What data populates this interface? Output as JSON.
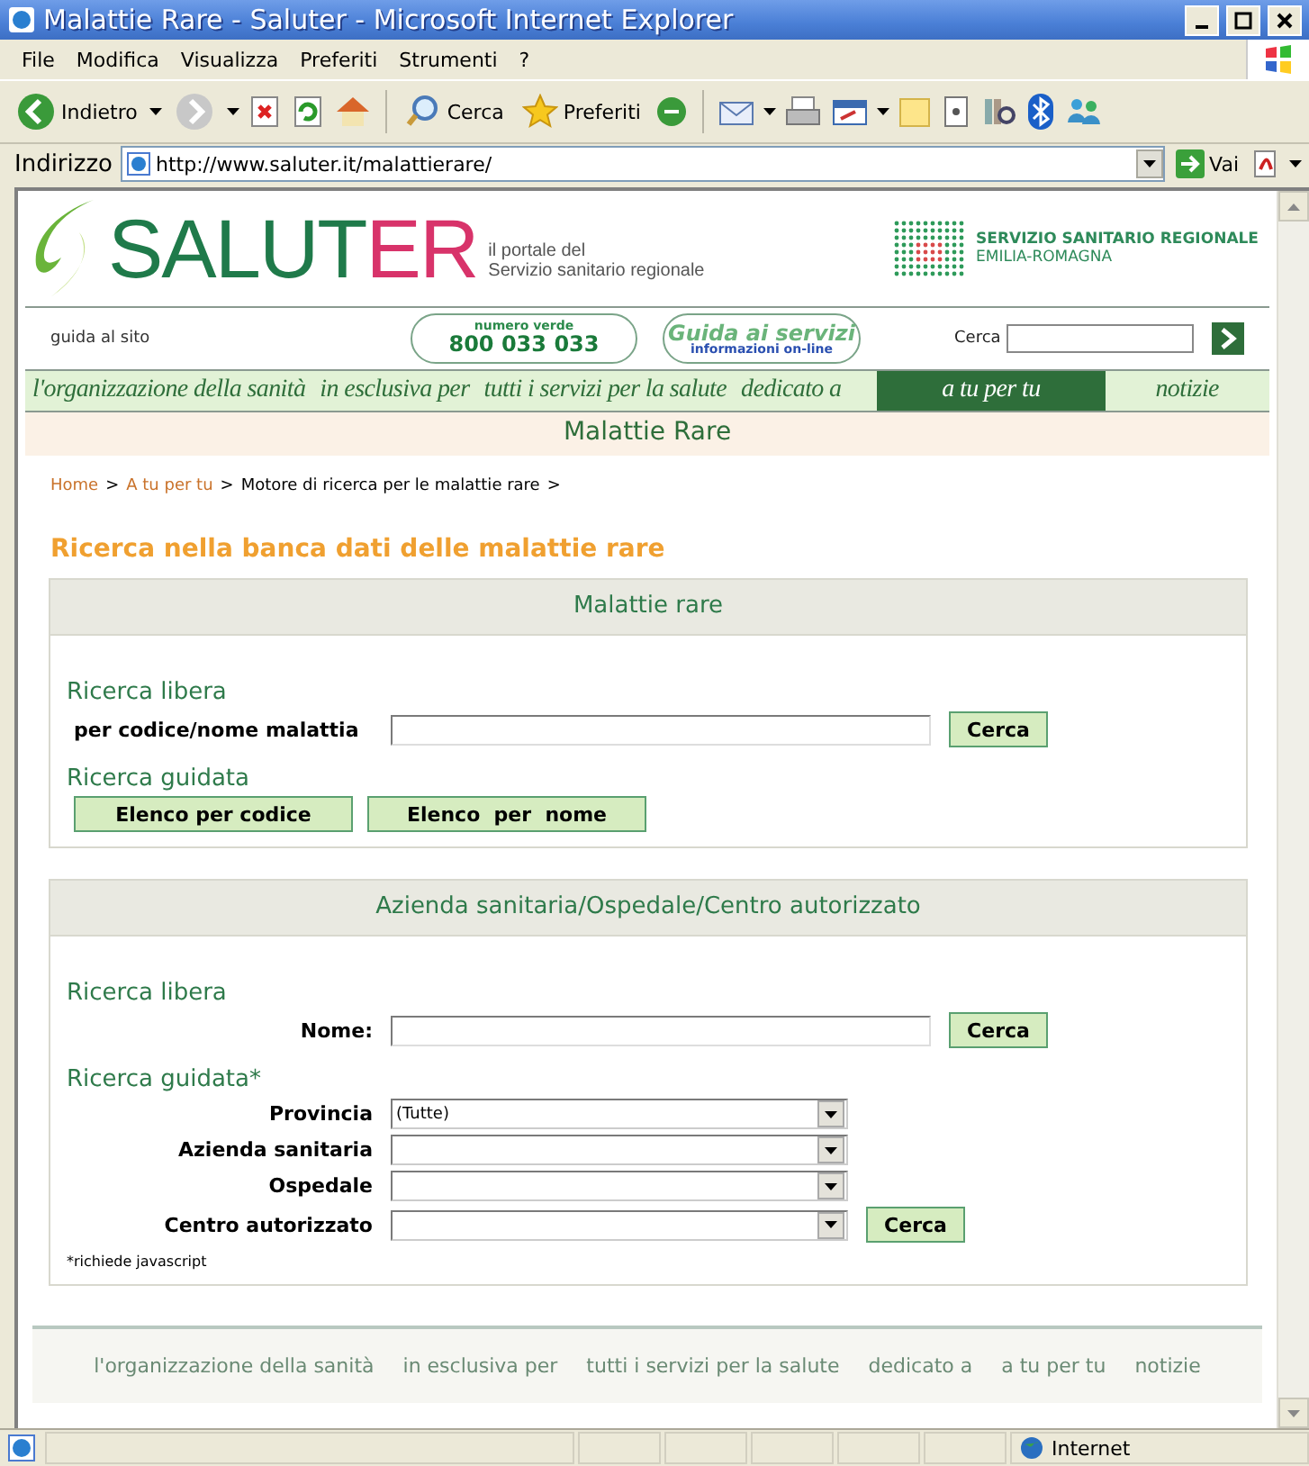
{
  "window": {
    "title": "Malattie Rare - Saluter - Microsoft Internet Explorer"
  },
  "menu": [
    "File",
    "Modifica",
    "Visualizza",
    "Preferiti",
    "Strumenti",
    "?"
  ],
  "toolbar": {
    "back": "Indietro",
    "search": "Cerca",
    "favorites": "Preferiti"
  },
  "address": {
    "label": "Indirizzo",
    "url": "http://www.saluter.it/malattierare/",
    "go": "Vai"
  },
  "header": {
    "logo_start": "SALUT",
    "logo_end": "ER",
    "tagline_1": "il portale del",
    "tagline_2": "Servizio sanitario regionale",
    "region_1": "SERVIZIO SANITARIO REGIONALE",
    "region_2": "EMILIA-ROMAGNA"
  },
  "utility": {
    "guide": "guida al sito",
    "phone_caption": "numero verde",
    "phone": "800 033 033",
    "services_title": "Guida ai servizi",
    "services_caption": "informazioni on-line",
    "search_label": "Cerca"
  },
  "nav": [
    {
      "label": "l'organizzazione della sanità",
      "selected": false
    },
    {
      "label": "in esclusiva per",
      "selected": false
    },
    {
      "label": "tutti i servizi per la salute",
      "selected": false
    },
    {
      "label": "dedicato a",
      "selected": false
    },
    {
      "label": "a tu per tu",
      "selected": true
    },
    {
      "label": "notizie",
      "selected": false
    }
  ],
  "section_title": "Malattie Rare",
  "breadcrumb": {
    "separator": ">",
    "items": [
      {
        "label": "Home",
        "link": true
      },
      {
        "label": "A tu per tu",
        "link": true
      },
      {
        "label": "Motore di ricerca per le malattie rare",
        "link": false
      }
    ]
  },
  "heading": "Ricerca nella banca dati delle malattie rare",
  "panels": [
    {
      "title": "Malattie rare",
      "groups": [
        {
          "heading": "Ricerca libera",
          "rows": [
            {
              "kind": "text",
              "label": "per codice/nome malattia",
              "button": "Cerca"
            }
          ]
        },
        {
          "heading": "Ricerca guidata",
          "rows": [
            {
              "kind": "buttons",
              "buttons": [
                "Elenco per codice",
                "Elenco  per  nome"
              ]
            }
          ]
        }
      ]
    },
    {
      "title": "Azienda sanitaria/Ospedale/Centro autorizzato",
      "groups": [
        {
          "heading": "Ricerca libera",
          "rows": [
            {
              "kind": "text",
              "label": "Nome:",
              "button": "Cerca"
            }
          ]
        },
        {
          "heading": "Ricerca guidata*",
          "rows": [
            {
              "kind": "select",
              "label": "Provincia",
              "value": "(Tutte)"
            },
            {
              "kind": "select",
              "label": "Azienda sanitaria"
            },
            {
              "kind": "select",
              "label": "Ospedale"
            },
            {
              "kind": "select",
              "label": "Centro autorizzato",
              "button": "Cerca"
            }
          ]
        }
      ],
      "note": "*richiede javascript"
    }
  ],
  "footer": [
    "l'organizzazione della sanità",
    "in esclusiva per",
    "tutti i servizi per la salute",
    "dedicato a",
    "a tu per tu",
    "notizie"
  ],
  "status": {
    "zone": "Internet"
  }
}
